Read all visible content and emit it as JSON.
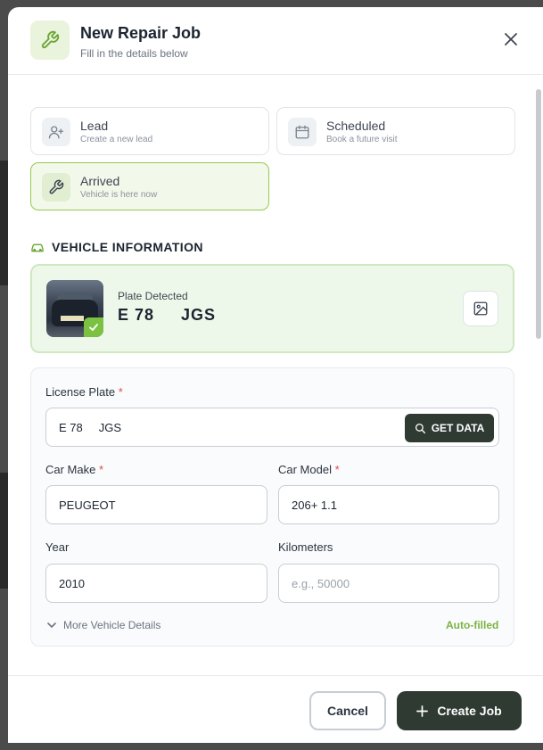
{
  "header": {
    "title": "New Repair Job",
    "subtitle": "Fill in the details below",
    "icon": "wrench-icon"
  },
  "job_types": [
    {
      "title": "Lead",
      "subtitle": "Create a new lead",
      "icon": "user-plus-icon",
      "selected": false
    },
    {
      "title": "Scheduled",
      "subtitle": "Book a future visit",
      "icon": "calendar-icon",
      "selected": false
    },
    {
      "title": "Arrived",
      "subtitle": "Vehicle is here now",
      "icon": "wrench-icon",
      "selected": true
    }
  ],
  "vehicle_section": {
    "title": "VEHICLE INFORMATION",
    "icon": "car-icon"
  },
  "plate_detection": {
    "label": "Plate Detected",
    "value": "E 78     JGS"
  },
  "form": {
    "license_plate": {
      "label": "License Plate",
      "required": "*",
      "value": "E 78     JGS",
      "button": "GET DATA"
    },
    "car_make": {
      "label": "Car Make",
      "required": "*",
      "value": "PEUGEOT"
    },
    "car_model": {
      "label": "Car Model",
      "required": "*",
      "value": "206+ 1.1"
    },
    "year": {
      "label": "Year",
      "value": "2010"
    },
    "kilometers": {
      "label": "Kilometers",
      "placeholder": "e.g., 50000"
    },
    "more_details": "More Vehicle Details",
    "autofilled": "Auto-filled"
  },
  "footer": {
    "cancel": "Cancel",
    "create": "Create Job"
  },
  "colors": {
    "accent_green": "#7cb342",
    "dark_button": "#2f3a33",
    "required_red": "#e14b4b"
  }
}
